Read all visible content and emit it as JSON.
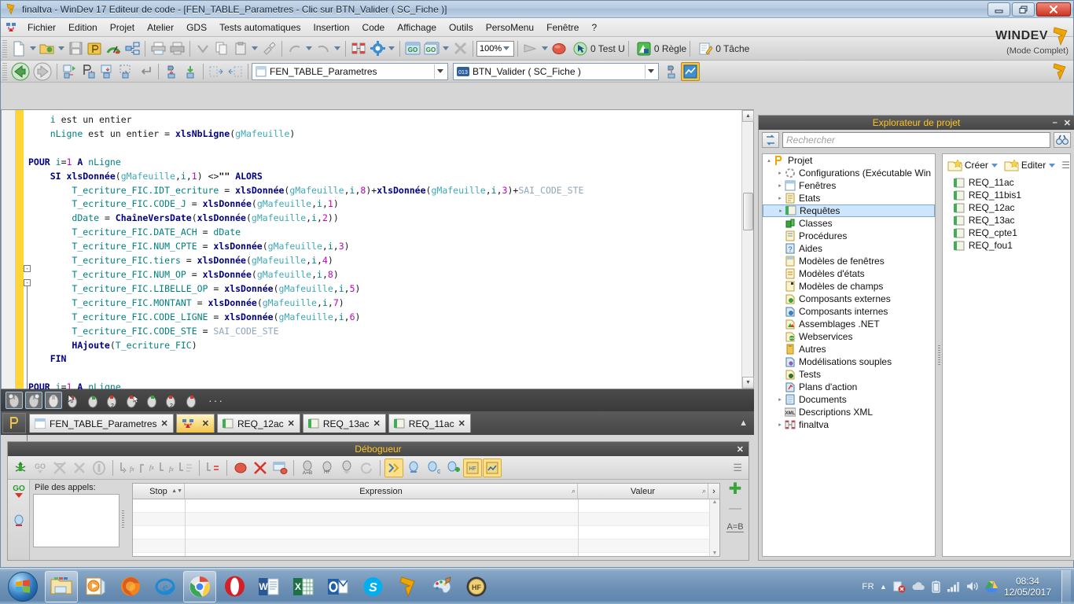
{
  "window": {
    "title": "finaltva - WinDev 17  Editeur de code - [FEN_TABLE_Parametres - Clic sur BTN_Valider ( SC_Fiche )]",
    "minimize_label": "—",
    "restore_label": "❐",
    "close_label": "✕"
  },
  "menu": {
    "items": [
      "Fichier",
      "Edition",
      "Projet",
      "Atelier",
      "GDS",
      "Tests automatiques",
      "Insertion",
      "Code",
      "Affichage",
      "Outils",
      "PersoMenu",
      "Fenêtre",
      "?"
    ]
  },
  "toolbar": {
    "zoom_value": "100%",
    "status": [
      {
        "icon": "test-u-icon",
        "label": "0 Test U"
      },
      {
        "icon": "regle-icon",
        "label": "0 Règle"
      },
      {
        "icon": "tache-icon",
        "label": "0 Tâche"
      }
    ],
    "brand": "WINDEV",
    "brand_mode": "(Mode Complet)"
  },
  "navbar": {
    "window_combo": "FEN_TABLE_Parametres",
    "element_combo": "BTN_Valider ( SC_Fiche )"
  },
  "code": {
    "lines": [
      [
        {
          "t": "    ",
          "c": "plain"
        },
        {
          "t": "i",
          "c": "var"
        },
        {
          "t": " est un entier",
          "c": "plain"
        }
      ],
      [
        {
          "t": "    ",
          "c": "plain"
        },
        {
          "t": "nLigne",
          "c": "var"
        },
        {
          "t": " est un entier = ",
          "c": "plain"
        },
        {
          "t": "xlsNbLigne",
          "c": "fn"
        },
        {
          "t": "(",
          "c": "plain"
        },
        {
          "t": "gMafeuille",
          "c": "glob"
        },
        {
          "t": ")",
          "c": "plain"
        }
      ],
      [],
      [
        {
          "t": "POUR ",
          "c": "kw"
        },
        {
          "t": "i",
          "c": "var"
        },
        {
          "t": "=",
          "c": "plain"
        },
        {
          "t": "1",
          "c": "num"
        },
        {
          "t": " A ",
          "c": "kw"
        },
        {
          "t": "nLigne",
          "c": "var"
        }
      ],
      [
        {
          "t": "    SI ",
          "c": "kw"
        },
        {
          "t": "xlsDonnée",
          "c": "fn"
        },
        {
          "t": "(",
          "c": "plain"
        },
        {
          "t": "gMafeuille",
          "c": "glob"
        },
        {
          "t": ",",
          "c": "plain"
        },
        {
          "t": "i",
          "c": "var"
        },
        {
          "t": ",",
          "c": "plain"
        },
        {
          "t": "1",
          "c": "num"
        },
        {
          "t": ") <>",
          "c": "plain"
        },
        {
          "t": "\"\"",
          "c": "str"
        },
        {
          "t": " ALORS",
          "c": "kw"
        }
      ],
      [
        {
          "t": "        ",
          "c": "plain"
        },
        {
          "t": "T_ecriture_FIC.IDT_ecriture",
          "c": "var"
        },
        {
          "t": " = ",
          "c": "plain"
        },
        {
          "t": "xlsDonnée",
          "c": "fn"
        },
        {
          "t": "(",
          "c": "plain"
        },
        {
          "t": "gMafeuille",
          "c": "glob"
        },
        {
          "t": ",",
          "c": "plain"
        },
        {
          "t": "i",
          "c": "var"
        },
        {
          "t": ",",
          "c": "plain"
        },
        {
          "t": "8",
          "c": "num"
        },
        {
          "t": ")+",
          "c": "plain"
        },
        {
          "t": "xlsDonnée",
          "c": "fn"
        },
        {
          "t": "(",
          "c": "plain"
        },
        {
          "t": "gMafeuille",
          "c": "glob"
        },
        {
          "t": ",",
          "c": "plain"
        },
        {
          "t": "i",
          "c": "var"
        },
        {
          "t": ",",
          "c": "plain"
        },
        {
          "t": "3",
          "c": "num"
        },
        {
          "t": ")+",
          "c": "plain"
        },
        {
          "t": "SAI_CODE_STE",
          "c": "ctrlname"
        }
      ],
      [
        {
          "t": "        ",
          "c": "plain"
        },
        {
          "t": "T_ecriture_FIC.CODE_J",
          "c": "var"
        },
        {
          "t": " = ",
          "c": "plain"
        },
        {
          "t": "xlsDonnée",
          "c": "fn"
        },
        {
          "t": "(",
          "c": "plain"
        },
        {
          "t": "gMafeuille",
          "c": "glob"
        },
        {
          "t": ",",
          "c": "plain"
        },
        {
          "t": "i",
          "c": "var"
        },
        {
          "t": ",",
          "c": "plain"
        },
        {
          "t": "1",
          "c": "num"
        },
        {
          "t": ")",
          "c": "plain"
        }
      ],
      [
        {
          "t": "        ",
          "c": "plain"
        },
        {
          "t": "dDate",
          "c": "var"
        },
        {
          "t": " = ",
          "c": "plain"
        },
        {
          "t": "ChaîneVersDate",
          "c": "fn"
        },
        {
          "t": "(",
          "c": "plain"
        },
        {
          "t": "xlsDonnée",
          "c": "fn"
        },
        {
          "t": "(",
          "c": "plain"
        },
        {
          "t": "gMafeuille",
          "c": "glob"
        },
        {
          "t": ",",
          "c": "plain"
        },
        {
          "t": "i",
          "c": "var"
        },
        {
          "t": ",",
          "c": "plain"
        },
        {
          "t": "2",
          "c": "num"
        },
        {
          "t": "))",
          "c": "plain"
        }
      ],
      [
        {
          "t": "        ",
          "c": "plain"
        },
        {
          "t": "T_ecriture_FIC.DATE_ACH",
          "c": "var"
        },
        {
          "t": " = ",
          "c": "plain"
        },
        {
          "t": "dDate",
          "c": "var"
        }
      ],
      [
        {
          "t": "        ",
          "c": "plain"
        },
        {
          "t": "T_ecriture_FIC.NUM_CPTE",
          "c": "var"
        },
        {
          "t": " = ",
          "c": "plain"
        },
        {
          "t": "xlsDonnée",
          "c": "fn"
        },
        {
          "t": "(",
          "c": "plain"
        },
        {
          "t": "gMafeuille",
          "c": "glob"
        },
        {
          "t": ",",
          "c": "plain"
        },
        {
          "t": "i",
          "c": "var"
        },
        {
          "t": ",",
          "c": "plain"
        },
        {
          "t": "3",
          "c": "num"
        },
        {
          "t": ")",
          "c": "plain"
        }
      ],
      [
        {
          "t": "        ",
          "c": "plain"
        },
        {
          "t": "T_ecriture_FIC.tiers",
          "c": "var"
        },
        {
          "t": " = ",
          "c": "plain"
        },
        {
          "t": "xlsDonnée",
          "c": "fn"
        },
        {
          "t": "(",
          "c": "plain"
        },
        {
          "t": "gMafeuille",
          "c": "glob"
        },
        {
          "t": ",",
          "c": "plain"
        },
        {
          "t": "i",
          "c": "var"
        },
        {
          "t": ",",
          "c": "plain"
        },
        {
          "t": "4",
          "c": "num"
        },
        {
          "t": ")",
          "c": "plain"
        }
      ],
      [
        {
          "t": "        ",
          "c": "plain"
        },
        {
          "t": "T_ecriture_FIC.NUM_OP",
          "c": "var"
        },
        {
          "t": " = ",
          "c": "plain"
        },
        {
          "t": "xlsDonnée",
          "c": "fn"
        },
        {
          "t": "(",
          "c": "plain"
        },
        {
          "t": "gMafeuille",
          "c": "glob"
        },
        {
          "t": ",",
          "c": "plain"
        },
        {
          "t": "i",
          "c": "var"
        },
        {
          "t": ",",
          "c": "plain"
        },
        {
          "t": "8",
          "c": "num"
        },
        {
          "t": ")",
          "c": "plain"
        }
      ],
      [
        {
          "t": "        ",
          "c": "plain"
        },
        {
          "t": "T_ecriture_FIC.LIBELLE_OP",
          "c": "var"
        },
        {
          "t": " = ",
          "c": "plain"
        },
        {
          "t": "xlsDonnée",
          "c": "fn"
        },
        {
          "t": "(",
          "c": "plain"
        },
        {
          "t": "gMafeuille",
          "c": "glob"
        },
        {
          "t": ",",
          "c": "plain"
        },
        {
          "t": "i",
          "c": "var"
        },
        {
          "t": ",",
          "c": "plain"
        },
        {
          "t": "5",
          "c": "num"
        },
        {
          "t": ")",
          "c": "plain"
        }
      ],
      [
        {
          "t": "        ",
          "c": "plain"
        },
        {
          "t": "T_ecriture_FIC.MONTANT",
          "c": "var"
        },
        {
          "t": " = ",
          "c": "plain"
        },
        {
          "t": "xlsDonnée",
          "c": "fn"
        },
        {
          "t": "(",
          "c": "plain"
        },
        {
          "t": "gMafeuille",
          "c": "glob"
        },
        {
          "t": ",",
          "c": "plain"
        },
        {
          "t": "i",
          "c": "var"
        },
        {
          "t": ",",
          "c": "plain"
        },
        {
          "t": "7",
          "c": "num"
        },
        {
          "t": ")",
          "c": "plain"
        }
      ],
      [
        {
          "t": "        ",
          "c": "plain"
        },
        {
          "t": "T_ecriture_FIC.CODE_LIGNE",
          "c": "var"
        },
        {
          "t": " = ",
          "c": "plain"
        },
        {
          "t": "xlsDonnée",
          "c": "fn"
        },
        {
          "t": "(",
          "c": "plain"
        },
        {
          "t": "gMafeuille",
          "c": "glob"
        },
        {
          "t": ",",
          "c": "plain"
        },
        {
          "t": "i",
          "c": "var"
        },
        {
          "t": ",",
          "c": "plain"
        },
        {
          "t": "6",
          "c": "num"
        },
        {
          "t": ")",
          "c": "plain"
        }
      ],
      [
        {
          "t": "        ",
          "c": "plain"
        },
        {
          "t": "T_ecriture_FIC.CODE_STE",
          "c": "var"
        },
        {
          "t": " = ",
          "c": "plain"
        },
        {
          "t": "SAI_CODE_STE",
          "c": "ctrlname"
        }
      ],
      [
        {
          "t": "        ",
          "c": "plain"
        },
        {
          "t": "HAjoute",
          "c": "fn"
        },
        {
          "t": "(",
          "c": "plain"
        },
        {
          "t": "T_ecriture_FIC",
          "c": "var"
        },
        {
          "t": ")",
          "c": "plain"
        }
      ],
      [
        {
          "t": "    FIN",
          "c": "kw"
        }
      ],
      [],
      [
        {
          "t": "POUR ",
          "c": "kw"
        },
        {
          "t": "i",
          "c": "var"
        },
        {
          "t": "=",
          "c": "plain"
        },
        {
          "t": "1",
          "c": "num"
        },
        {
          "t": " A ",
          "c": "kw"
        },
        {
          "t": "nLigne",
          "c": "var"
        }
      ]
    ]
  },
  "tabs": {
    "home_icon": "windev-p-icon",
    "items": [
      {
        "label": "FEN_TABLE_Parametres",
        "icon": "window-icon",
        "active": false,
        "close": "✕"
      },
      {
        "label": "",
        "icon": "code-icon",
        "active": true,
        "close": "✕"
      },
      {
        "label": "REQ_12ac",
        "icon": "query-icon",
        "active": false,
        "close": "✕"
      },
      {
        "label": "REQ_13ac",
        "icon": "query-icon",
        "active": false,
        "close": "✕"
      },
      {
        "label": "REQ_11ac",
        "icon": "query-icon",
        "active": false,
        "close": "✕"
      }
    ],
    "collapse": "▲"
  },
  "debugger": {
    "title": "Débogueur",
    "close": "✕",
    "call_stack_label": "Pile des appels:",
    "columns": [
      "Stop",
      "Expression",
      "Valeur"
    ],
    "rows": [],
    "add_btn": "✚",
    "remove_btn": "—",
    "assign_btn": "A=B",
    "go_label": "GO"
  },
  "explorer": {
    "title": "Explorateur de projet",
    "minimize": "–",
    "close": "✕",
    "search_placeholder": "Rechercher",
    "search_value": "",
    "create_label": "Créer",
    "edit_label": "Editer",
    "tree": [
      {
        "label": "Projet",
        "icon": "project-icon",
        "depth": 0,
        "expander": "▴",
        "selected": false
      },
      {
        "label": "Configurations (Exécutable Win",
        "icon": "config-icon",
        "depth": 1,
        "expander": "▸",
        "selected": false
      },
      {
        "label": "Fenêtres",
        "icon": "window-icon",
        "depth": 1,
        "expander": "▸",
        "selected": false
      },
      {
        "label": "Etats",
        "icon": "report-icon",
        "depth": 1,
        "expander": "▸",
        "selected": false
      },
      {
        "label": "Requêtes",
        "icon": "query-icon",
        "depth": 1,
        "expander": "▸",
        "selected": true
      },
      {
        "label": "Classes",
        "icon": "class-icon",
        "depth": 1,
        "expander": "",
        "selected": false
      },
      {
        "label": "Procédures",
        "icon": "procedure-icon",
        "depth": 1,
        "expander": "",
        "selected": false
      },
      {
        "label": "Aides",
        "icon": "help-icon",
        "depth": 1,
        "expander": "",
        "selected": false
      },
      {
        "label": "Modèles de fenêtres",
        "icon": "window-template-icon",
        "depth": 1,
        "expander": "",
        "selected": false
      },
      {
        "label": "Modèles d'états",
        "icon": "report-template-icon",
        "depth": 1,
        "expander": "",
        "selected": false
      },
      {
        "label": "Modèles de champs",
        "icon": "field-template-icon",
        "depth": 1,
        "expander": "",
        "selected": false
      },
      {
        "label": "Composants externes",
        "icon": "external-component-icon",
        "depth": 1,
        "expander": "",
        "selected": false
      },
      {
        "label": "Composants internes",
        "icon": "internal-component-icon",
        "depth": 1,
        "expander": "",
        "selected": false
      },
      {
        "label": "Assemblages .NET",
        "icon": "dotnet-icon",
        "depth": 1,
        "expander": "",
        "selected": false
      },
      {
        "label": "Webservices",
        "icon": "webservice-icon",
        "depth": 1,
        "expander": "",
        "selected": false
      },
      {
        "label": "Autres",
        "icon": "other-icon",
        "depth": 1,
        "expander": "",
        "selected": false
      },
      {
        "label": "Modélisations souples",
        "icon": "modeling-icon",
        "depth": 1,
        "expander": "",
        "selected": false
      },
      {
        "label": "Tests",
        "icon": "test-icon",
        "depth": 1,
        "expander": "",
        "selected": false
      },
      {
        "label": "Plans d'action",
        "icon": "action-plan-icon",
        "depth": 1,
        "expander": "",
        "selected": false
      },
      {
        "label": "Documents",
        "icon": "document-icon",
        "depth": 1,
        "expander": "▸",
        "selected": false
      },
      {
        "label": "Descriptions XML",
        "icon": "xml-icon",
        "depth": 1,
        "expander": "",
        "selected": false
      },
      {
        "label": "finaltva",
        "icon": "analysis-icon",
        "depth": 1,
        "expander": "▸",
        "selected": false
      }
    ],
    "list": [
      {
        "label": "REQ_11ac",
        "icon": "query-icon"
      },
      {
        "label": "REQ_11bis1",
        "icon": "query-icon"
      },
      {
        "label": "REQ_12ac",
        "icon": "query-icon"
      },
      {
        "label": "REQ_13ac",
        "icon": "query-icon"
      },
      {
        "label": "REQ_cpte1",
        "icon": "query-icon"
      },
      {
        "label": "REQ_fou1",
        "icon": "query-icon"
      }
    ]
  },
  "taskbar": {
    "start_label": "Start",
    "apps": [
      {
        "name": "windows-explorer-icon",
        "running": true
      },
      {
        "name": "media-player-icon",
        "running": false
      },
      {
        "name": "firefox-icon",
        "running": false
      },
      {
        "name": "internet-explorer-icon",
        "running": false
      },
      {
        "name": "chrome-icon",
        "running": true
      },
      {
        "name": "opera-icon",
        "running": false
      },
      {
        "name": "word-icon",
        "running": false
      },
      {
        "name": "excel-icon",
        "running": false
      },
      {
        "name": "outlook-icon",
        "running": false
      },
      {
        "name": "skype-icon",
        "running": false
      },
      {
        "name": "windev-icon",
        "running": false
      },
      {
        "name": "paint-icon",
        "running": false
      },
      {
        "name": "hyperfilesql-icon",
        "running": false
      }
    ],
    "language": "FR",
    "time": "08:34",
    "date": "12/05/2017"
  },
  "colors": {
    "accent_yellow": "#ffc425",
    "gutter_yellow": "#ffd633",
    "selection_blue": "#cfe5fb",
    "close_red": "#cf3322"
  }
}
